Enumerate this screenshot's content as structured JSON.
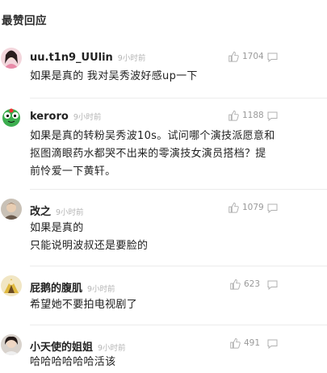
{
  "section": {
    "title": "最赞回应"
  },
  "comments": [
    {
      "username": "uu.t1n9_UUlin",
      "time": "9小时前",
      "likes": "1704",
      "lines": [
        "如果是真的 我对吴秀波好感up一下"
      ]
    },
    {
      "username": "keroro",
      "time": "9小时前",
      "likes": "1188",
      "lines": [
        "如果是真的转粉吴秀波10s。试问哪个演技派愿意和",
        "抠图滴眼药水都哭不出来的零演技女演员搭档？提",
        "前怜爱一下黄轩。"
      ]
    },
    {
      "username": "改之",
      "time": "9小时前",
      "likes": "1079",
      "lines": [
        "如果是真的",
        "只能说明波叔还是要脸的"
      ]
    },
    {
      "username": "屁鹅的腹肌",
      "time": "9小时前",
      "likes": "623",
      "lines": [
        "希望她不要拍电视剧了"
      ]
    },
    {
      "username": "小天使的姐姐",
      "time": "9小时前",
      "likes": "491",
      "lines": [
        "哈哈哈哈哈哈活该"
      ]
    }
  ],
  "colors": {
    "text": "#222222",
    "meta": "#b5b5b5",
    "like_count": "#9a9a9a",
    "divider": "#ececec"
  }
}
